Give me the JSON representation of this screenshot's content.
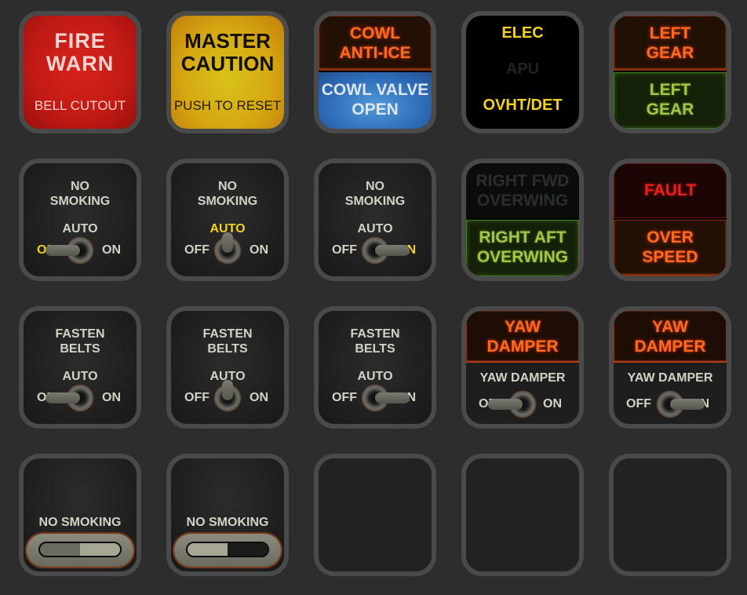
{
  "colors": {
    "background": "#2d2d2d",
    "key_border": "#4a4a4a",
    "key_empty": "#222222",
    "amber": "#ff6a22",
    "yellow": "#f2d21a",
    "green": "#a6c34a",
    "red": "#e5201c",
    "blue": "#2f6cb8"
  },
  "keys": [
    {
      "type": "annunciator",
      "name": "fire-warn",
      "main": "FIRE\nWARN",
      "sub": "BELL CUTOUT",
      "state": "on",
      "color": "red"
    },
    {
      "type": "annunciator",
      "name": "master-caution",
      "main": "MASTER\nCAUTION",
      "sub": "PUSH TO RESET",
      "state": "on",
      "color": "yellow"
    },
    {
      "type": "split",
      "name": "cowl-anti-ice",
      "top": "COWL\nANTI-ICE",
      "top_state": "on",
      "top_color": "amber",
      "bottom": "COWL VALVE\nOPEN",
      "bottom_state": "on",
      "bottom_color": "blue"
    },
    {
      "type": "triple",
      "name": "elec-apu-ovht",
      "lines": [
        {
          "text": "ELEC",
          "state": "on"
        },
        {
          "text": "APU",
          "state": "off"
        },
        {
          "text": "OVHT/DET",
          "state": "on"
        }
      ]
    },
    {
      "type": "split",
      "name": "left-gear",
      "top": "LEFT\nGEAR",
      "top_state": "on",
      "top_color": "amber",
      "bottom": "LEFT\nGEAR",
      "bottom_state": "on",
      "bottom_color": "green"
    },
    {
      "type": "toggle3",
      "name": "no-smoking-switch",
      "title": "NO\nSMOKING",
      "auto": "AUTO",
      "off": "OFF",
      "on": "ON",
      "position": "OFF"
    },
    {
      "type": "toggle3",
      "name": "no-smoking-switch",
      "title": "NO\nSMOKING",
      "auto": "AUTO",
      "off": "OFF",
      "on": "ON",
      "position": "AUTO"
    },
    {
      "type": "toggle3",
      "name": "no-smoking-switch",
      "title": "NO\nSMOKING",
      "auto": "AUTO",
      "off": "OFF",
      "on": "ON",
      "position": "ON"
    },
    {
      "type": "split",
      "name": "right-overwing",
      "top": "RIGHT FWD\nOVERWING",
      "top_state": "off",
      "top_color": "green",
      "bottom": "RIGHT AFT\nOVERWING",
      "bottom_state": "on",
      "bottom_color": "green"
    },
    {
      "type": "split",
      "name": "fault-overspeed",
      "top": "FAULT",
      "top_state": "on",
      "top_color": "red",
      "bottom": "OVER\nSPEED",
      "bottom_state": "on",
      "bottom_color": "amber"
    },
    {
      "type": "toggle3",
      "name": "fasten-belts-switch",
      "title": "FASTEN\nBELTS",
      "auto": "AUTO",
      "off": "OFF",
      "on": "ON",
      "position": "OFF",
      "highlight": false
    },
    {
      "type": "toggle3",
      "name": "fasten-belts-switch",
      "title": "FASTEN\nBELTS",
      "auto": "AUTO",
      "off": "OFF",
      "on": "ON",
      "position": "AUTO",
      "highlight": false
    },
    {
      "type": "toggle3",
      "name": "fasten-belts-switch",
      "title": "FASTEN\nBELTS",
      "auto": "AUTO",
      "off": "OFF",
      "on": "ON",
      "position": "ON",
      "highlight": false
    },
    {
      "type": "yaw",
      "name": "yaw-damper-switch",
      "annunciator": "YAW\nDAMPER",
      "title": "YAW DAMPER",
      "off": "OFF",
      "on": "ON",
      "position": "OFF"
    },
    {
      "type": "yaw",
      "name": "yaw-damper-switch",
      "annunciator": "YAW\nDAMPER",
      "title": "YAW DAMPER",
      "off": "OFF",
      "on": "ON",
      "position": "ON"
    },
    {
      "type": "slider",
      "name": "no-smoking-slider",
      "title": "NO SMOKING",
      "position": "right"
    },
    {
      "type": "slider",
      "name": "no-smoking-slider",
      "title": "NO SMOKING",
      "position": "left"
    },
    {
      "type": "empty",
      "name": "empty-key"
    },
    {
      "type": "empty",
      "name": "empty-key"
    },
    {
      "type": "empty",
      "name": "empty-key"
    }
  ]
}
